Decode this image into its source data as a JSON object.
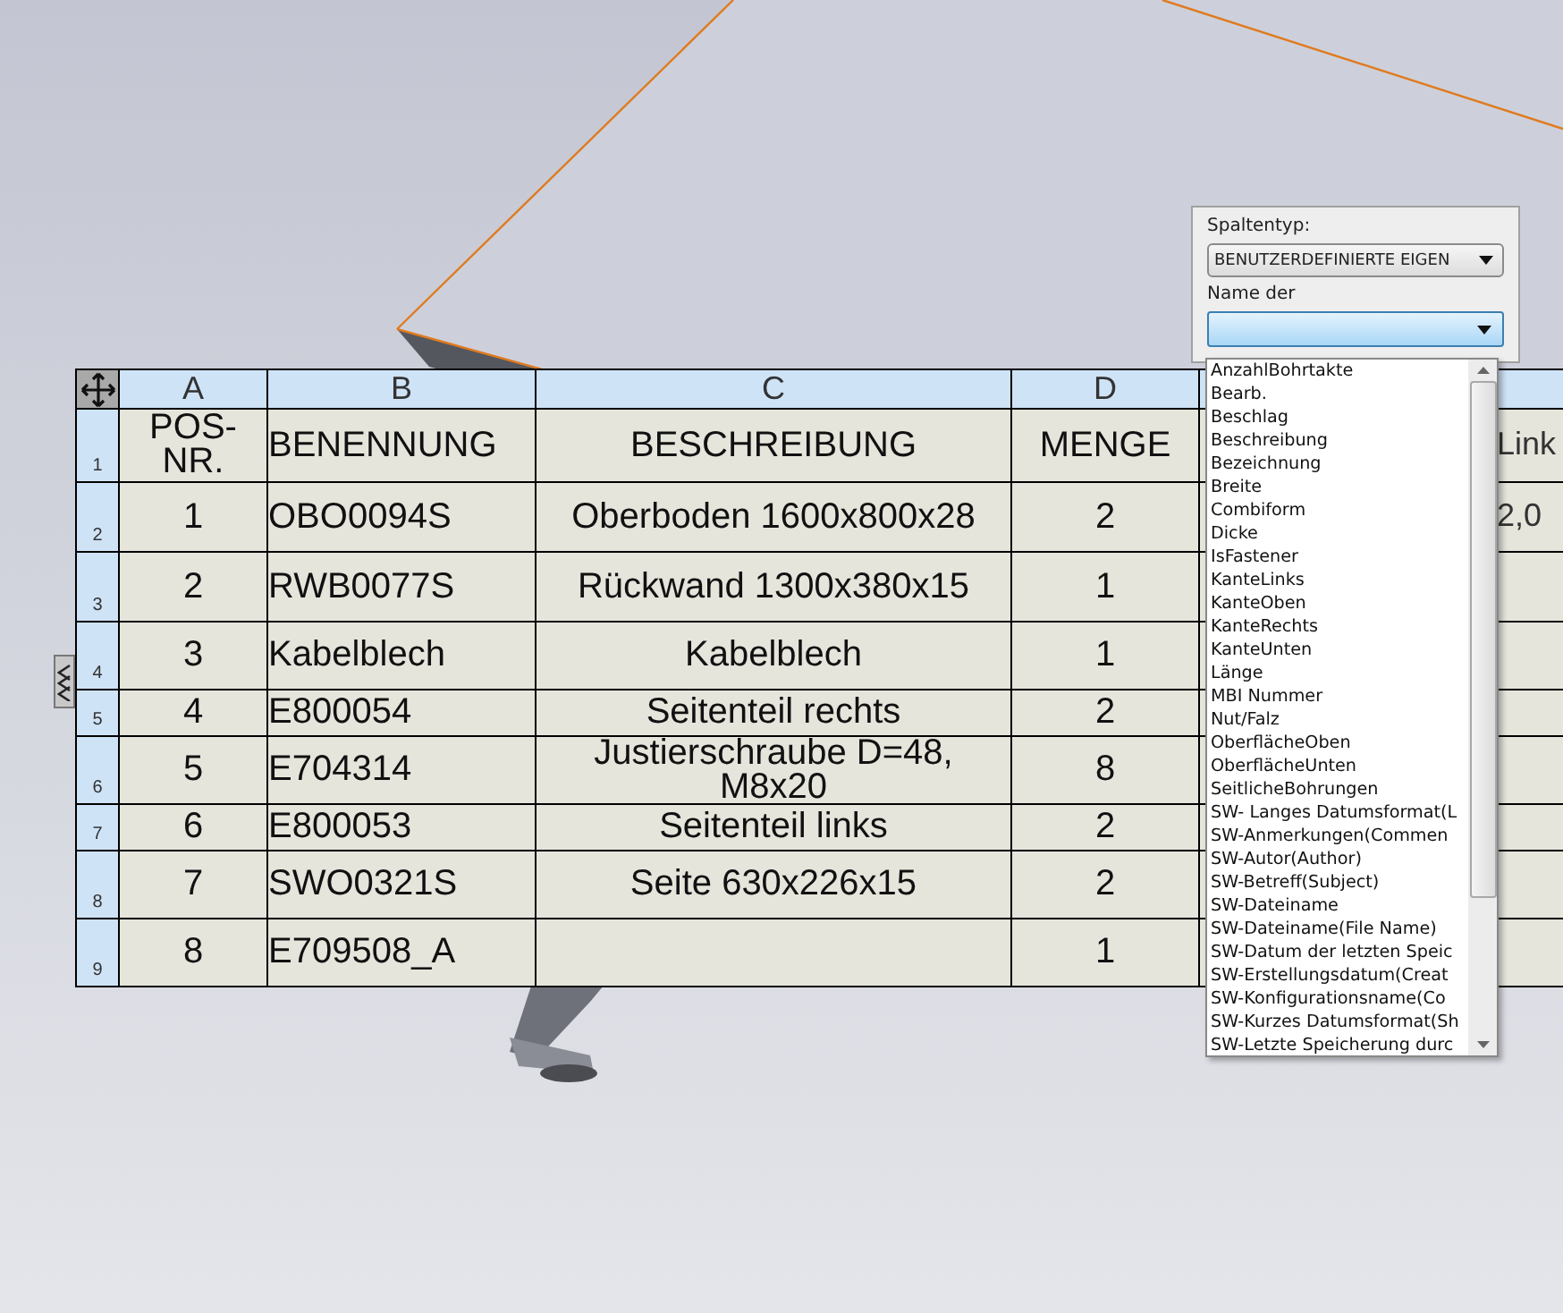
{
  "table": {
    "columns": [
      "A",
      "B",
      "C",
      "D"
    ],
    "rows": [
      {
        "number": "1",
        "cells": [
          "POS-NR.",
          "BENENNUNG",
          "BESCHREIBUNG",
          "MENGE",
          "Link"
        ]
      },
      {
        "number": "2",
        "cells": [
          "1",
          "OBO0094S",
          "Oberboden 1600x800x28",
          "2",
          "2,0"
        ]
      },
      {
        "number": "3",
        "cells": [
          "2",
          "RWB0077S",
          "Rückwand 1300x380x15",
          "1"
        ]
      },
      {
        "number": "4",
        "cells": [
          "3",
          "Kabelblech",
          "Kabelblech",
          "1"
        ]
      },
      {
        "number": "5",
        "cells": [
          "4",
          "E800054",
          "Seitenteil rechts",
          "2"
        ]
      },
      {
        "number": "6",
        "cells": [
          "5",
          "E704314",
          "Justierschraube D=48, M8x20",
          "8"
        ]
      },
      {
        "number": "7",
        "cells": [
          "6",
          "E800053",
          "Seitenteil links",
          "2"
        ]
      },
      {
        "number": "8",
        "cells": [
          "7",
          "SWO0321S",
          "Seite 630x226x15",
          "2"
        ]
      },
      {
        "number": "9",
        "cells": [
          "8",
          "E709508_A",
          "",
          "1"
        ]
      }
    ]
  },
  "column_panel": {
    "type_label": "Spaltentyp:",
    "type_value": "BENUTZERDEFINIERTE EIGEN",
    "name_label": "Name der",
    "options": [
      "AnzahlBohrtakte",
      "Bearb.",
      "Beschlag",
      "Beschreibung",
      "Bezeichnung",
      "Breite",
      "Combiform",
      "Dicke",
      "IsFastener",
      "KanteLinks",
      "KanteOben",
      "KanteRechts",
      "KanteUnten",
      "Länge",
      "MBI Nummer",
      "Nut/Falz",
      "OberflächeOben",
      "OberflächeUnten",
      "SeitlicheBohrungen",
      "SW- Langes Datumsformat(L",
      "SW-Anmerkungen(Commen",
      "SW-Autor(Author)",
      "SW-Betreff(Subject)",
      "SW-Dateiname",
      "SW-Dateiname(File Name)",
      "SW-Datum der letzten Speic",
      "SW-Erstellungsdatum(Creat",
      "SW-Konfigurationsname(Co",
      "SW-Kurzes Datumsformat(Sh",
      "SW-Letzte Speicherung durc"
    ]
  }
}
